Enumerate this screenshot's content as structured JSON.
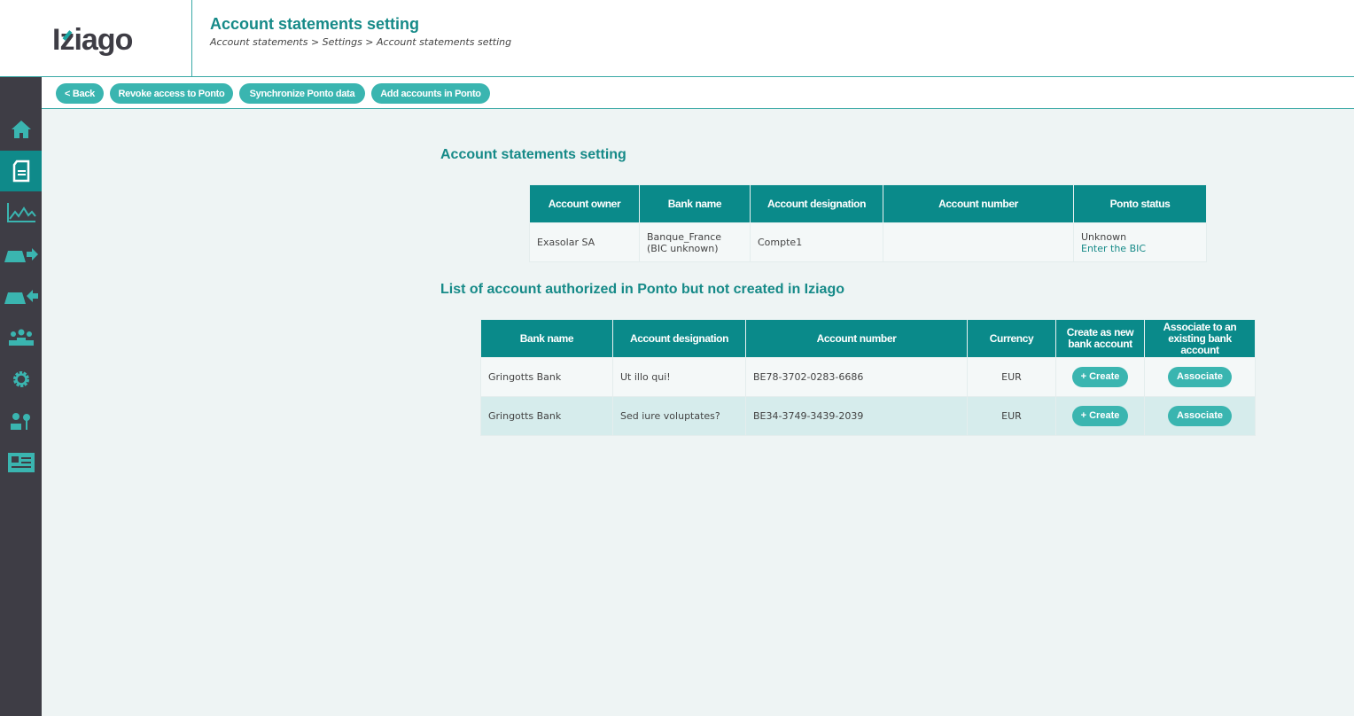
{
  "app": {
    "logo": "Iziago",
    "title": "Account statements setting",
    "breadcrumb": "Account statements > Settings > Account statements setting"
  },
  "sidebar": [
    "home",
    "account-statements",
    "analytics",
    "outgoing-payments",
    "incoming-payments",
    "team",
    "settings",
    "user-access",
    "contact-card"
  ],
  "toolbar": {
    "back": "< Back",
    "revoke": "Revoke access to Ponto",
    "sync": "Synchronize Ponto data",
    "add": "Add accounts in Ponto"
  },
  "section1": {
    "title": "Account statements setting",
    "headers": [
      "Account owner",
      "Bank name",
      "Account designation",
      "Account number",
      "Ponto status"
    ],
    "row": {
      "owner": "Exasolar SA",
      "bank": "Banque_France",
      "bank_note": "(BIC unknown)",
      "designation": "Compte1",
      "number": "",
      "status": "Unknown",
      "status_link": "Enter the BIC"
    }
  },
  "section2": {
    "title": "List of account authorized in Ponto but not created in Iziago",
    "headers": [
      "Bank name",
      "Account designation",
      "Account number",
      "Currency",
      "Create as new bank account",
      "Associate to an existing bank account"
    ],
    "rows": [
      {
        "bank": "Gringotts Bank",
        "designation": "Ut illo qui!",
        "number": "BE78-3702-0283-6686",
        "currency": "EUR",
        "create": "+ Create",
        "associate": "Associate"
      },
      {
        "bank": "Gringotts Bank",
        "designation": "Sed iure voluptates?",
        "number": "BE34-3749-3439-2039",
        "currency": "EUR",
        "create": "+ Create",
        "associate": "Associate"
      }
    ]
  },
  "colors": {
    "accent": "#0a8a8a",
    "button": "#3ab5b0",
    "sidebar": "#3e3d45"
  }
}
